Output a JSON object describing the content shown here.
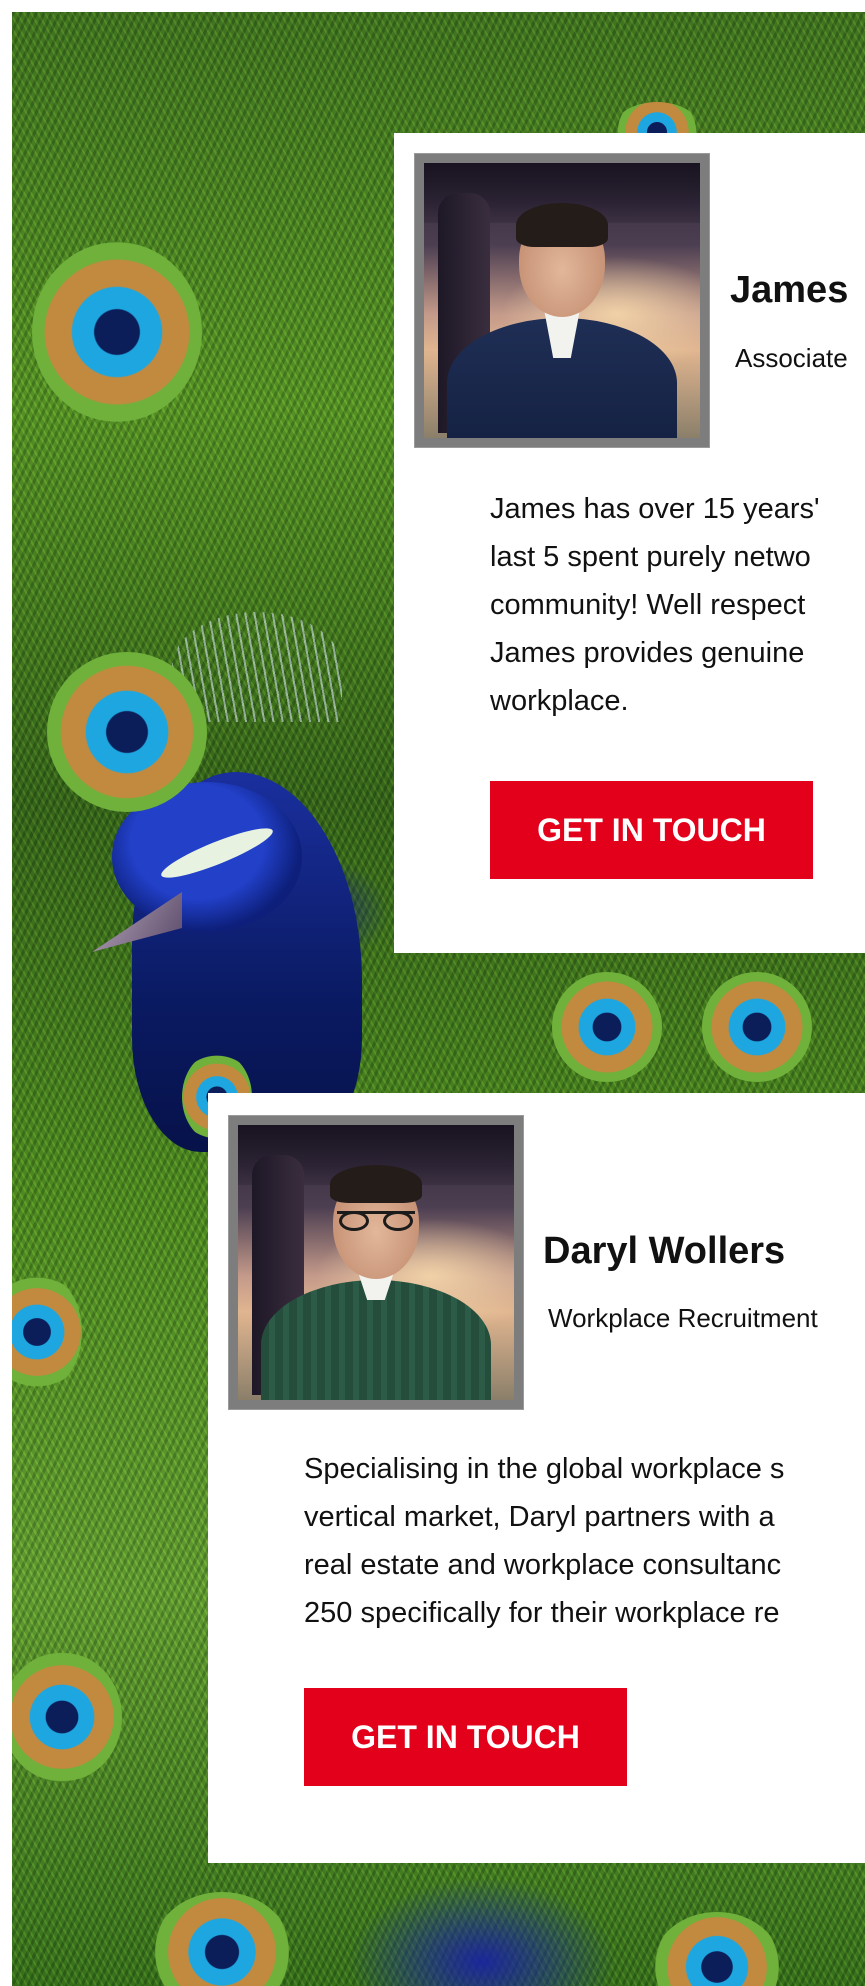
{
  "colors": {
    "accent": "#e2001a",
    "card_background": "#ffffff",
    "text": "#111111"
  },
  "background": {
    "image": "peacock-feathers-image"
  },
  "profiles": [
    {
      "name": "James",
      "role": "Associate",
      "bio": "James has over 15 years'\nlast 5 spent purely netwo\ncommunity! Well respect\nJames provides genuine\nworkplace.",
      "cta_label": "GET IN TOUCH",
      "photo": "headshot-photo"
    },
    {
      "name": "Daryl Wollers",
      "role": "Workplace Recruitment",
      "bio": "Specialising in the global workplace s\nvertical market, Daryl partners with a\nreal estate and workplace consultanc\n250 specifically for their workplace re",
      "cta_label": "GET IN TOUCH",
      "photo": "headshot-photo"
    }
  ]
}
